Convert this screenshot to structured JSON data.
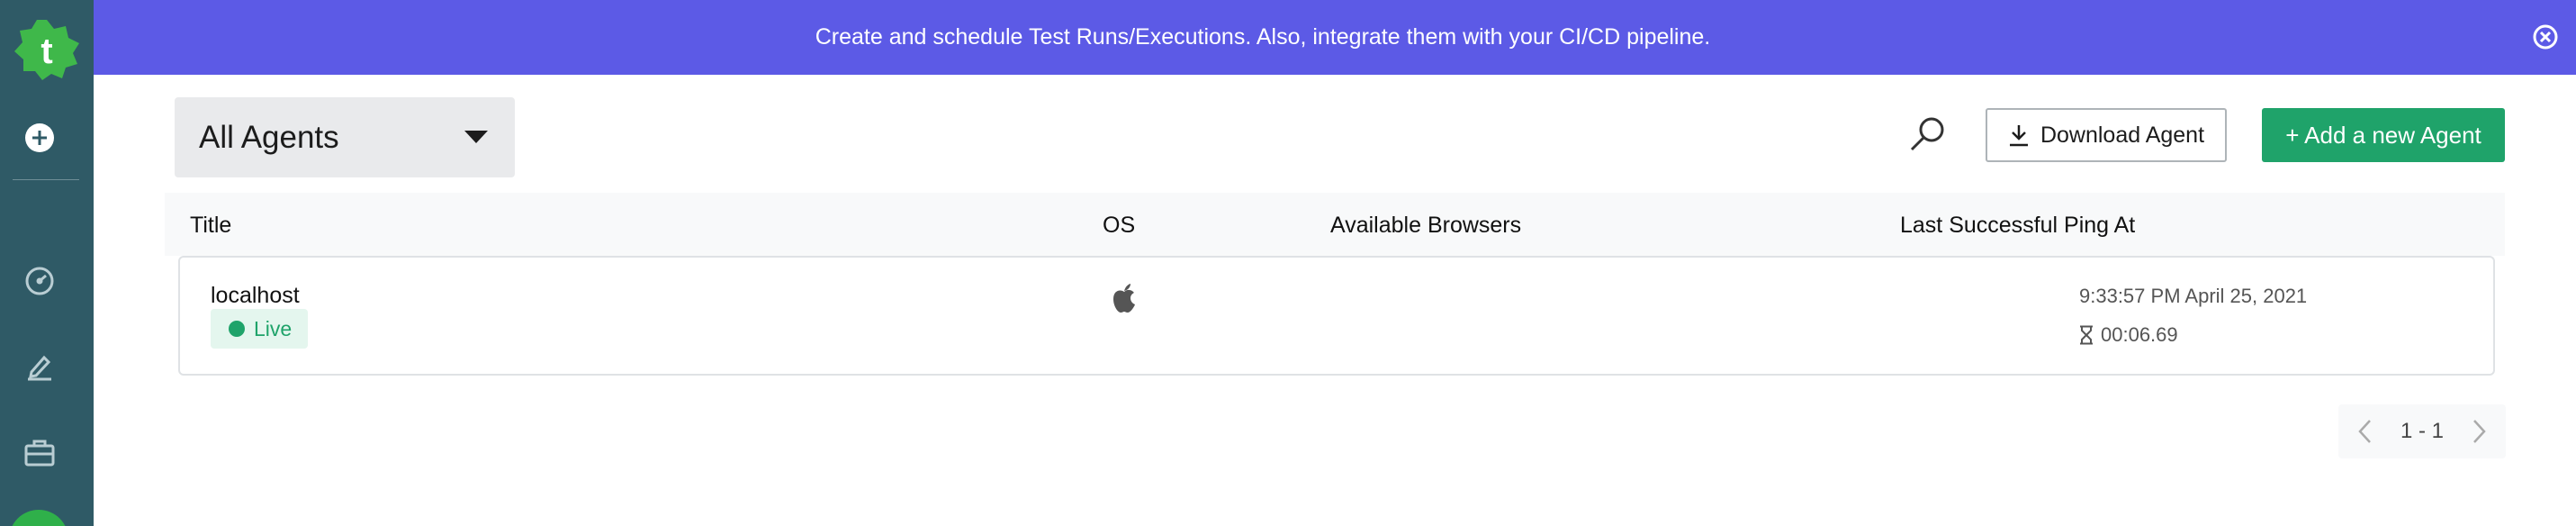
{
  "banner": {
    "text": "Create and schedule Test Runs/Executions. Also, integrate them with your CI/CD pipeline."
  },
  "toolbar": {
    "filter_selected": "All Agents",
    "download_label": "Download Agent",
    "add_label": "+ Add a new Agent"
  },
  "table": {
    "columns": [
      "Title",
      "OS",
      "Available Browsers",
      "Last Successful Ping At"
    ],
    "rows": [
      {
        "title": "localhost",
        "status": "Live",
        "os_icon": "apple-icon",
        "browsers": "",
        "last_ping": "9:33:57 PM April 25, 2021",
        "duration": "00:06.69"
      }
    ]
  },
  "pagination": {
    "range": "1 - 1"
  },
  "icons": {
    "logo": "testsigma-logo",
    "sidebar": [
      "add-circle-icon",
      "dashboard-gauge-icon",
      "edit-pencil-icon",
      "briefcase-icon"
    ],
    "close": "close-circle-icon",
    "search": "search-icon",
    "download": "download-icon"
  },
  "colors": {
    "sidebar": "#2f5a66",
    "banner": "#5c5ae6",
    "accent_green": "#1fa36a",
    "live_bg": "#e4f6ee"
  }
}
